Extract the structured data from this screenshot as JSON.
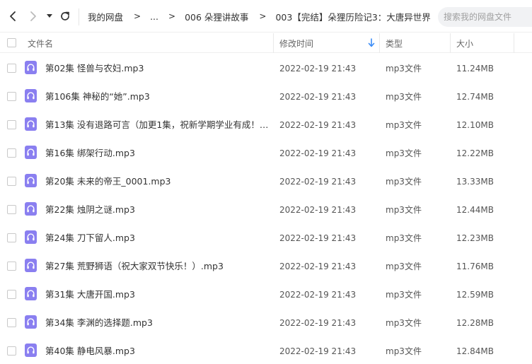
{
  "toolbar": {
    "back_icon": "chevron-left-icon",
    "forward_icon": "chevron-right-icon",
    "dropdown_icon": "caret-down-icon",
    "refresh_icon": "refresh-icon"
  },
  "breadcrumb": {
    "items": [
      "我的网盘",
      "...",
      "006 朵狸讲故事",
      "003【完结】朵狸历险记3：大唐异世界"
    ],
    "separator": ">"
  },
  "search": {
    "placeholder": "搜索我的网盘文件"
  },
  "columns": {
    "name": "文件名",
    "modified": "修改时间",
    "type": "类型",
    "size": "大小"
  },
  "colors": {
    "accent": "#3b8cf6",
    "audio_icon": "#8a7ff0"
  },
  "files": [
    {
      "name": "第02集 怪兽与农妇.mp3",
      "modified": "2022-02-19 21:43",
      "type": "mp3文件",
      "size": "11.24MB"
    },
    {
      "name": "第106集 神秘的“她”.mp3",
      "modified": "2022-02-19 21:43",
      "type": "mp3文件",
      "size": "12.74MB"
    },
    {
      "name": "第13集 没有退路可言（加更1集，祝新学期学业有成！）....",
      "modified": "2022-02-19 21:43",
      "type": "mp3文件",
      "size": "12.10MB"
    },
    {
      "name": "第16集 绑架行动.mp3",
      "modified": "2022-02-19 21:43",
      "type": "mp3文件",
      "size": "12.22MB"
    },
    {
      "name": "第20集 未来的帝王_0001.mp3",
      "modified": "2022-02-19 21:43",
      "type": "mp3文件",
      "size": "13.33MB"
    },
    {
      "name": "第22集 烛阴之谜.mp3",
      "modified": "2022-02-19 21:43",
      "type": "mp3文件",
      "size": "12.44MB"
    },
    {
      "name": "第24集 刀下留人.mp3",
      "modified": "2022-02-19 21:43",
      "type": "mp3文件",
      "size": "12.23MB"
    },
    {
      "name": "第27集 荒野狮语（祝大家双节快乐！）.mp3",
      "modified": "2022-02-19 21:43",
      "type": "mp3文件",
      "size": "11.76MB"
    },
    {
      "name": "第31集 大唐开国.mp3",
      "modified": "2022-02-19 21:43",
      "type": "mp3文件",
      "size": "12.59MB"
    },
    {
      "name": "第34集 李渊的选择题.mp3",
      "modified": "2022-02-19 21:43",
      "type": "mp3文件",
      "size": "12.28MB"
    },
    {
      "name": "第40集 静电风暴.mp3",
      "modified": "2022-02-19 21:43",
      "type": "mp3文件",
      "size": "12.84MB"
    }
  ]
}
